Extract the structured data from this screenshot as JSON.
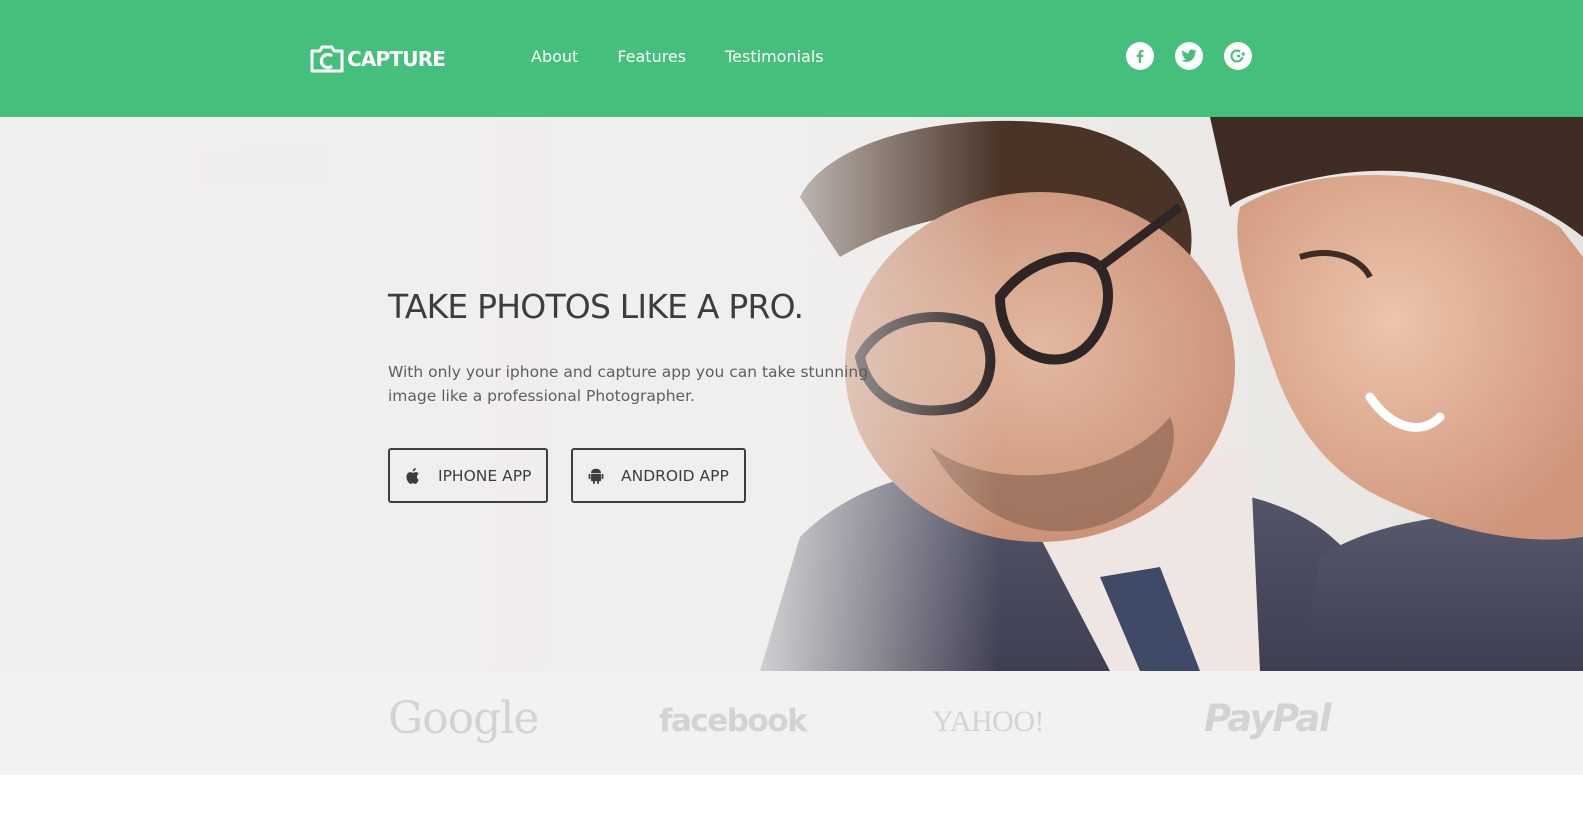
{
  "brand": {
    "name": "CAPTURE",
    "accent_color": "#44c07c"
  },
  "nav": {
    "items": [
      {
        "label": "About"
      },
      {
        "label": "Features"
      },
      {
        "label": "Testimonials"
      }
    ]
  },
  "social": [
    {
      "icon": "facebook-icon"
    },
    {
      "icon": "twitter-icon"
    },
    {
      "icon": "google-plus-icon"
    }
  ],
  "hero": {
    "title": "TAKE PHOTOS LIKE A PRO.",
    "text": "With only your iphone and capture app you can take stunning image like a professional Photographer.",
    "buttons": [
      {
        "label": "IPHONE APP",
        "icon": "apple-icon"
      },
      {
        "label": "ANDROID APP",
        "icon": "android-icon"
      }
    ]
  },
  "partners": [
    {
      "name": "Google"
    },
    {
      "name": "facebook"
    },
    {
      "name": "YAHOO!"
    },
    {
      "name": "PayPal"
    }
  ]
}
